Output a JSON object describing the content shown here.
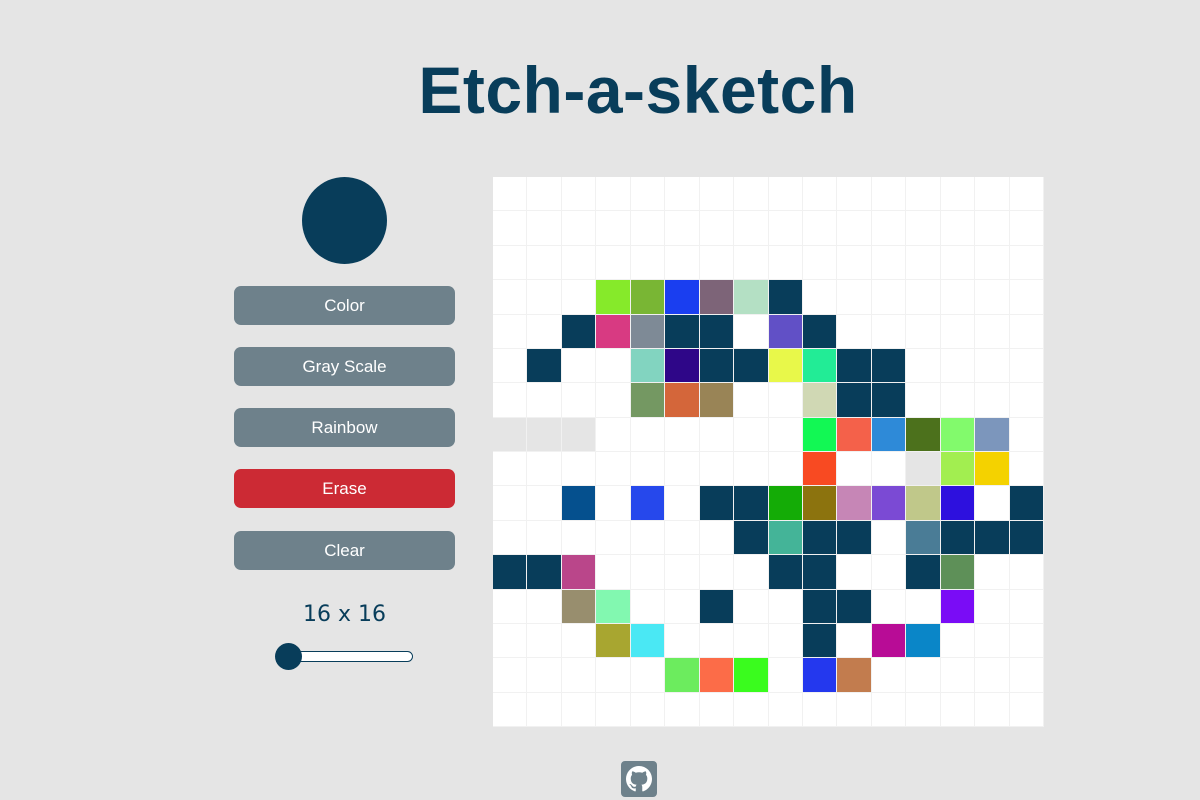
{
  "title": "Etch-a-sketch",
  "current_color": "#083d5a",
  "buttons": {
    "color": "Color",
    "grayscale": "Gray Scale",
    "rainbow": "Rainbow",
    "erase": "Erase",
    "clear": "Clear"
  },
  "size_label": "16 x 16",
  "grid_size": 16,
  "colors": {
    "primary": "#083d5a",
    "button": "#6e818b",
    "erase": "#cc2a34",
    "background": "#e5e5e5"
  },
  "footer_icon": "github-icon",
  "grid_rows": [
    [
      "#ffffff",
      "#ffffff",
      "#ffffff",
      "#ffffff",
      "#ffffff",
      "#ffffff",
      "#ffffff",
      "#ffffff",
      "#ffffff",
      "#ffffff",
      "#ffffff",
      "#ffffff",
      "#ffffff",
      "#ffffff",
      "#ffffff",
      "#ffffff"
    ],
    [
      "#ffffff",
      "#ffffff",
      "#ffffff",
      "#ffffff",
      "#ffffff",
      "#ffffff",
      "#ffffff",
      "#ffffff",
      "#ffffff",
      "#ffffff",
      "#ffffff",
      "#ffffff",
      "#ffffff",
      "#ffffff",
      "#ffffff",
      "#ffffff"
    ],
    [
      "#ffffff",
      "#ffffff",
      "#ffffff",
      "#ffffff",
      "#ffffff",
      "#ffffff",
      "#ffffff",
      "#ffffff",
      "#ffffff",
      "#ffffff",
      "#ffffff",
      "#ffffff",
      "#ffffff",
      "#ffffff",
      "#ffffff",
      "#ffffff"
    ],
    [
      "#ffffff",
      "#ffffff",
      "#ffffff",
      "#86ea2a",
      "#79b634",
      "#1a3ef0",
      "#7d6478",
      "#b4e0c4",
      "#083d5a",
      "#ffffff",
      "#ffffff",
      "#ffffff",
      "#ffffff",
      "#ffffff",
      "#ffffff",
      "#ffffff"
    ],
    [
      "#ffffff",
      "#ffffff",
      "#083d5a",
      "#d83a82",
      "#7e8a96",
      "#083d5a",
      "#083d5a",
      "#ffffff",
      "#6150c6",
      "#083d5a",
      "#ffffff",
      "#ffffff",
      "#ffffff",
      "#ffffff",
      "#ffffff",
      "#ffffff"
    ],
    [
      "#ffffff",
      "#083d5a",
      "#ffffff",
      "#ffffff",
      "#82d4c0",
      "#2e0688",
      "#083d5a",
      "#083d5a",
      "#e8f84a",
      "#22ec96",
      "#083d5a",
      "#083d5a",
      "#ffffff",
      "#ffffff",
      "#ffffff",
      "#ffffff"
    ],
    [
      "#ffffff",
      "#ffffff",
      "#ffffff",
      "#ffffff",
      "#749862",
      "#d4663a",
      "#998456",
      "#ffffff",
      "#ffffff",
      "#d0d8b4",
      "#083d5a",
      "#083d5a",
      "#ffffff",
      "#ffffff",
      "#ffffff",
      "#ffffff"
    ],
    [
      "#e5e5e5",
      "#e5e5e5",
      "#e5e5e5",
      "#ffffff",
      "#ffffff",
      "#ffffff",
      "#ffffff",
      "#ffffff",
      "#ffffff",
      "#12f854",
      "#f4614a",
      "#2e8ad8",
      "#4c711c",
      "#82fa6c",
      "#7c96bc",
      "#ffffff"
    ],
    [
      "#ffffff",
      "#ffffff",
      "#ffffff",
      "#ffffff",
      "#ffffff",
      "#ffffff",
      "#ffffff",
      "#ffffff",
      "#ffffff",
      "#f84a22",
      "#ffffff",
      "#ffffff",
      "#e5e5e5",
      "#a2ee50",
      "#f4d200",
      "#ffffff"
    ],
    [
      "#ffffff",
      "#ffffff",
      "#05508e",
      "#ffffff",
      "#2648ec",
      "#ffffff",
      "#083d5a",
      "#083d5a",
      "#14ac06",
      "#8c730e",
      "#c686b6",
      "#7b4ad4",
      "#c0c88a",
      "#2d10de",
      "#ffffff",
      "#083d5a"
    ],
    [
      "#ffffff",
      "#ffffff",
      "#ffffff",
      "#ffffff",
      "#ffffff",
      "#ffffff",
      "#ffffff",
      "#083d5a",
      "#44b498",
      "#083d5a",
      "#083d5a",
      "#ffffff",
      "#4a7c96",
      "#083d5a",
      "#083d5a",
      "#083d5a"
    ],
    [
      "#083d5a",
      "#083d5a",
      "#ba468a",
      "#ffffff",
      "#ffffff",
      "#ffffff",
      "#ffffff",
      "#ffffff",
      "#083d5a",
      "#083d5a",
      "#ffffff",
      "#ffffff",
      "#083d5a",
      "#5e9058",
      "#ffffff",
      "#ffffff"
    ],
    [
      "#ffffff",
      "#ffffff",
      "#988e6e",
      "#82f8b0",
      "#ffffff",
      "#ffffff",
      "#083d5a",
      "#ffffff",
      "#ffffff",
      "#083d5a",
      "#083d5a",
      "#ffffff",
      "#ffffff",
      "#7a0cf6",
      "#ffffff",
      "#ffffff"
    ],
    [
      "#ffffff",
      "#ffffff",
      "#ffffff",
      "#a8a630",
      "#4ae8f4",
      "#ffffff",
      "#ffffff",
      "#ffffff",
      "#ffffff",
      "#083d5a",
      "#ffffff",
      "#b80c96",
      "#0a86c8",
      "#ffffff",
      "#ffffff",
      "#ffffff"
    ],
    [
      "#ffffff",
      "#ffffff",
      "#ffffff",
      "#ffffff",
      "#ffffff",
      "#6cec5e",
      "#fc6c48",
      "#3afc1e",
      "#ffffff",
      "#2438ee",
      "#c27c4e",
      "#ffffff",
      "#ffffff",
      "#ffffff",
      "#ffffff",
      "#ffffff"
    ],
    [
      "#ffffff",
      "#ffffff",
      "#ffffff",
      "#ffffff",
      "#ffffff",
      "#ffffff",
      "#ffffff",
      "#ffffff",
      "#ffffff",
      "#ffffff",
      "#ffffff",
      "#ffffff",
      "#ffffff",
      "#ffffff",
      "#ffffff",
      "#ffffff"
    ]
  ]
}
